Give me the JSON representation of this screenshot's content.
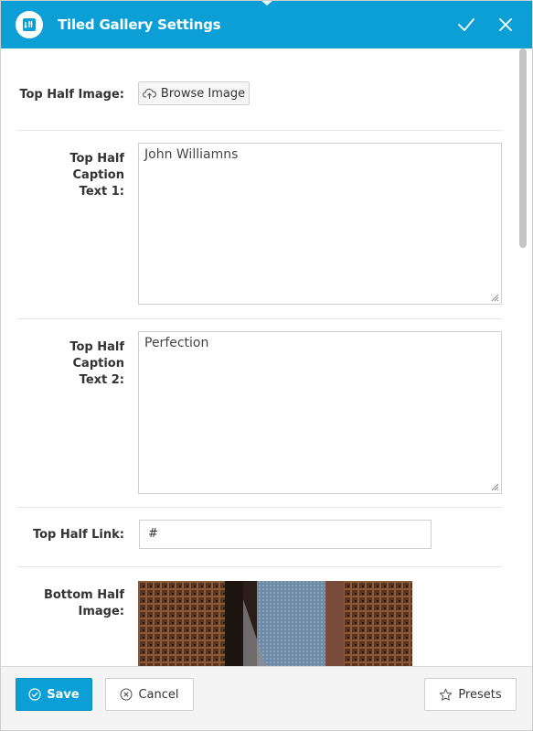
{
  "dialog": {
    "title": "Tiled Gallery Settings",
    "logo_icon": "tiled-gallery-icon",
    "confirm_icon": "check-icon",
    "close_icon": "close-icon",
    "accent_color": "#0b9fd6"
  },
  "fields": {
    "top_half_image": {
      "label": "Top Half Image:",
      "button_label": "Browse Image",
      "icon": "cloud-upload-icon"
    },
    "top_half_caption_1": {
      "label_line1": "Top Half Caption",
      "label_line2": "Text 1:",
      "value": "John Williamns"
    },
    "top_half_caption_2": {
      "label_line1": "Top Half Caption",
      "label_line2": "Text 2:",
      "value": "Perfection"
    },
    "top_half_link": {
      "label": "Top Half Link:",
      "value": "#"
    },
    "bottom_half_image": {
      "label_line1": "Bottom Half",
      "label_line2": "Image:"
    }
  },
  "footer": {
    "save_label": "Save",
    "save_icon": "check-circle-icon",
    "cancel_label": "Cancel",
    "cancel_icon": "x-circle-icon",
    "presets_label": "Presets",
    "presets_icon": "star-icon"
  }
}
